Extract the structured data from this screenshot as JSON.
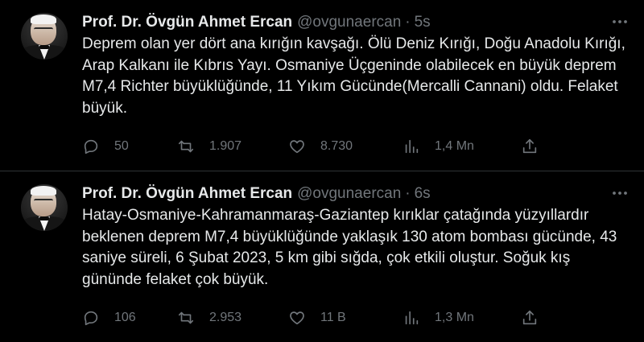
{
  "tweets": [
    {
      "author": {
        "name": "Prof. Dr. Övgün Ahmet Ercan",
        "handle": "@ovgunaercan",
        "separator": "·",
        "time": "5s"
      },
      "text": "Deprem olan yer dört ana kırığın kavşağı. Ölü Deniz Kırığı, Doğu Anadolu Kırığı, Arap Kalkanı ile Kıbrıs Yayı. Osmaniye Üçgeninde olabilecek en büyük deprem M7,4 Richter büyüklüğünde, 11 Yıkım Gücünde(Mercalli Cannani) oldu. Felaket büyük.",
      "stats": {
        "replies": "50",
        "retweets": "1.907",
        "likes": "8.730",
        "views": "1,4 Mn"
      }
    },
    {
      "author": {
        "name": "Prof. Dr. Övgün Ahmet Ercan",
        "handle": "@ovgunaercan",
        "separator": "·",
        "time": "6s"
      },
      "text": "Hatay-Osmaniye-Kahramanmaraş-Gaziantep kırıklar çatağında yüzyıllardır beklenen deprem M7,4 büyüklüğünde yaklaşık 130 atom bombası gücünde, 43 saniye süreli, 6 Şubat 2023, 5 km gibi sığda, çok etkili oluştur. Soğuk kış gününde felaket çok büyük.",
      "stats": {
        "replies": "106",
        "retweets": "2.953",
        "likes": "11 B",
        "views": "1,3 Mn"
      }
    }
  ],
  "icons": {
    "more": "more-icon",
    "reply": "reply-icon",
    "retweet": "retweet-icon",
    "like": "heart-icon",
    "views": "views-icon",
    "share": "share-icon"
  },
  "colors": {
    "background": "#000000",
    "text": "#e7e9ea",
    "muted": "#71767b",
    "divider": "#2f3336"
  }
}
